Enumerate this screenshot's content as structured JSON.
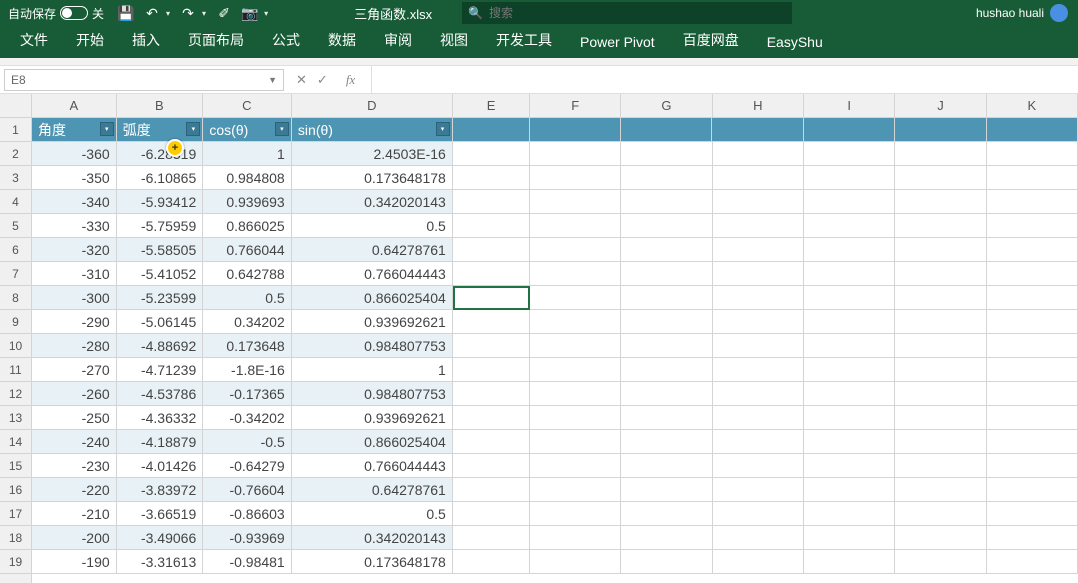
{
  "title": {
    "autosave": "自动保存",
    "toggle_state": "关",
    "filename": "三角函数.xlsx",
    "search_placeholder": "搜索",
    "user": "hushao huali"
  },
  "tabs": [
    "文件",
    "开始",
    "插入",
    "页面布局",
    "公式",
    "数据",
    "审阅",
    "视图",
    "开发工具",
    "Power Pivot",
    "百度网盘",
    "EasyShu"
  ],
  "namebox": "E8",
  "columns": [
    "A",
    "B",
    "C",
    "D",
    "E",
    "F",
    "G",
    "H",
    "I",
    "J",
    "K"
  ],
  "headers": [
    "角度",
    "弧度",
    "cos(θ)",
    "sin(θ)"
  ],
  "rows": [
    {
      "n": 2,
      "a": "-360",
      "b": "-6.28319",
      "c": "1",
      "d": "2.4503E-16"
    },
    {
      "n": 3,
      "a": "-350",
      "b": "-6.10865",
      "c": "0.984808",
      "d": "0.173648178"
    },
    {
      "n": 4,
      "a": "-340",
      "b": "-5.93412",
      "c": "0.939693",
      "d": "0.342020143"
    },
    {
      "n": 5,
      "a": "-330",
      "b": "-5.75959",
      "c": "0.866025",
      "d": "0.5"
    },
    {
      "n": 6,
      "a": "-320",
      "b": "-5.58505",
      "c": "0.766044",
      "d": "0.64278761"
    },
    {
      "n": 7,
      "a": "-310",
      "b": "-5.41052",
      "c": "0.642788",
      "d": "0.766044443"
    },
    {
      "n": 8,
      "a": "-300",
      "b": "-5.23599",
      "c": "0.5",
      "d": "0.866025404"
    },
    {
      "n": 9,
      "a": "-290",
      "b": "-5.06145",
      "c": "0.34202",
      "d": "0.939692621"
    },
    {
      "n": 10,
      "a": "-280",
      "b": "-4.88692",
      "c": "0.173648",
      "d": "0.984807753"
    },
    {
      "n": 11,
      "a": "-270",
      "b": "-4.71239",
      "c": "-1.8E-16",
      "d": "1"
    },
    {
      "n": 12,
      "a": "-260",
      "b": "-4.53786",
      "c": "-0.17365",
      "d": "0.984807753"
    },
    {
      "n": 13,
      "a": "-250",
      "b": "-4.36332",
      "c": "-0.34202",
      "d": "0.939692621"
    },
    {
      "n": 14,
      "a": "-240",
      "b": "-4.18879",
      "c": "-0.5",
      "d": "0.866025404"
    },
    {
      "n": 15,
      "a": "-230",
      "b": "-4.01426",
      "c": "-0.64279",
      "d": "0.766044443"
    },
    {
      "n": 16,
      "a": "-220",
      "b": "-3.83972",
      "c": "-0.76604",
      "d": "0.64278761"
    },
    {
      "n": 17,
      "a": "-210",
      "b": "-3.66519",
      "c": "-0.86603",
      "d": "0.5"
    },
    {
      "n": 18,
      "a": "-200",
      "b": "-3.49066",
      "c": "-0.93969",
      "d": "0.342020143"
    },
    {
      "n": 19,
      "a": "-190",
      "b": "-3.31613",
      "c": "-0.98481",
      "d": "0.173648178"
    }
  ],
  "icons": {
    "save": "💾",
    "undo": "↶",
    "redo": "↷",
    "brush": "✐",
    "camera": "📷",
    "search": "🔍",
    "cancel": "✕",
    "enter": "✓",
    "fx": "fx"
  }
}
